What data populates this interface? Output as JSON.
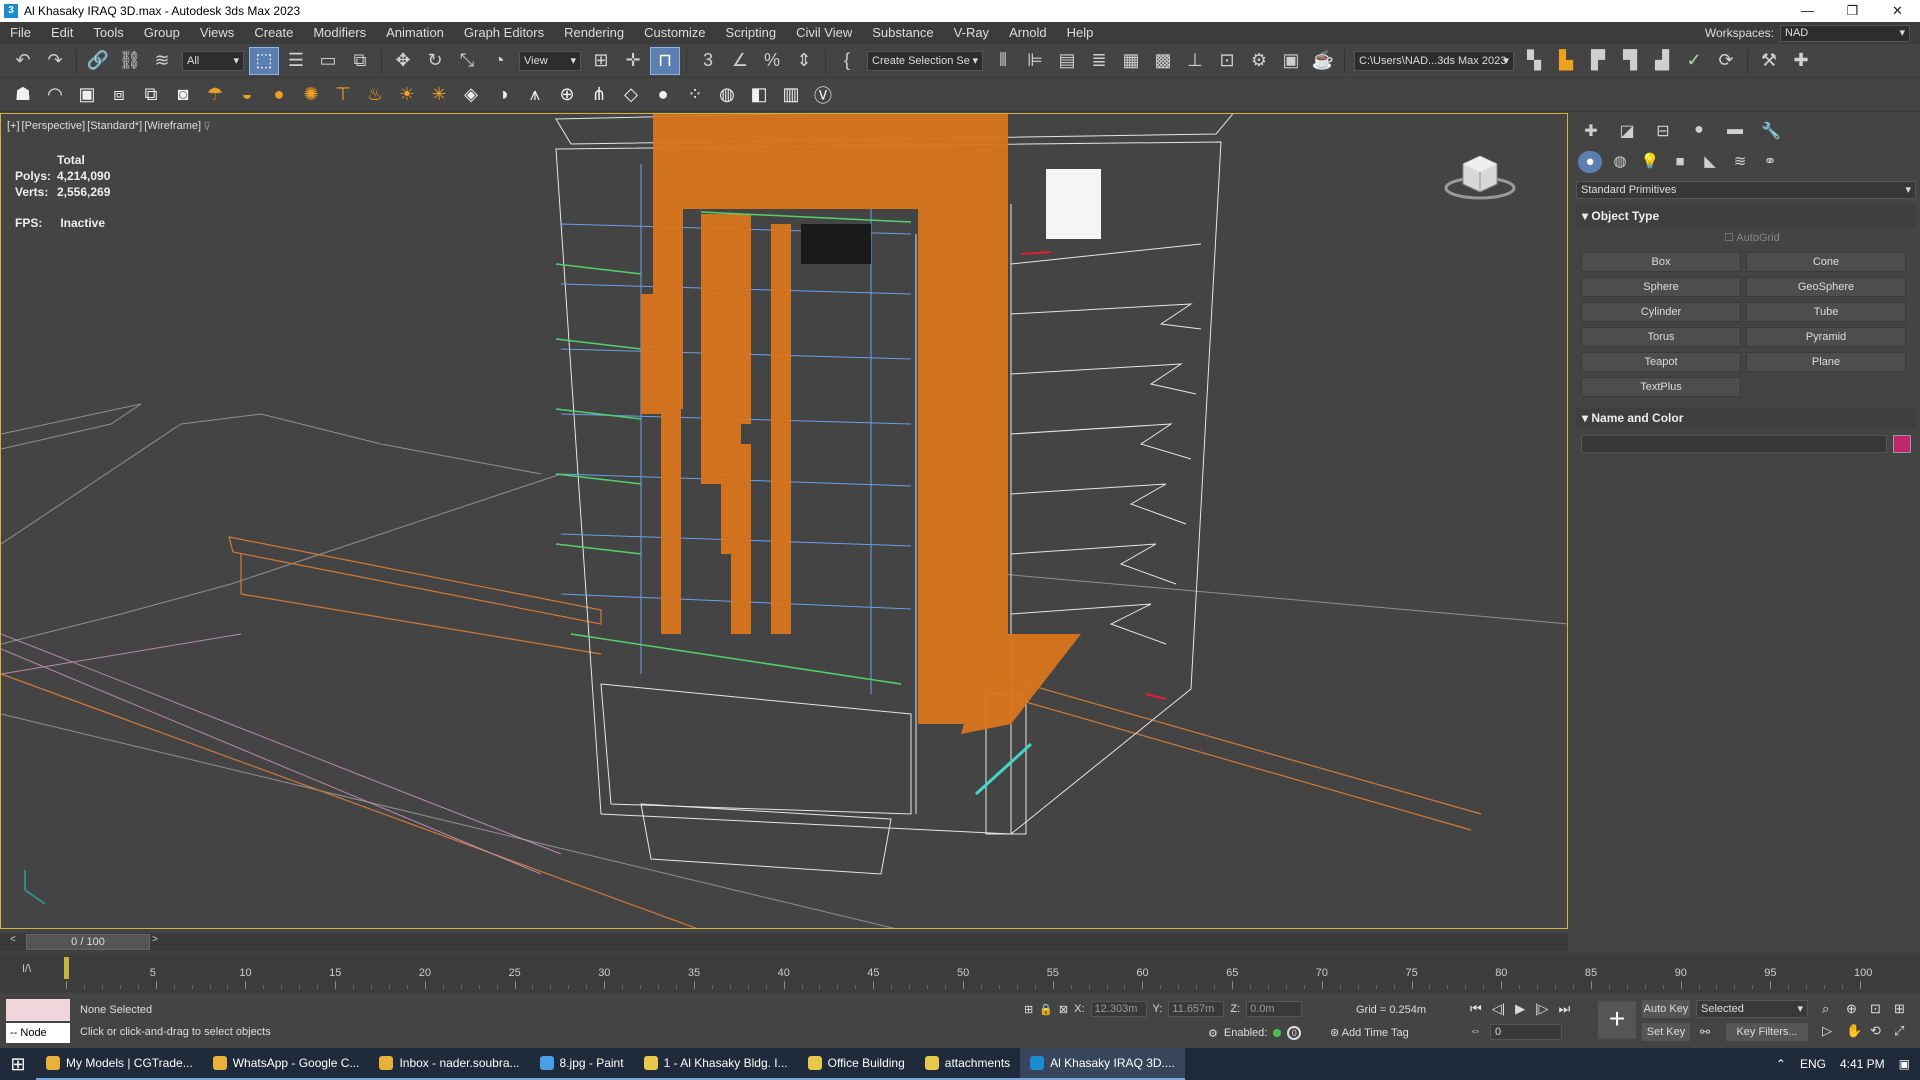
{
  "window": {
    "title": "Al Khasaky IRAQ 3D.max - Autodesk 3ds Max 2023",
    "controls": [
      "—",
      "❐",
      "✕"
    ]
  },
  "menu": [
    "File",
    "Edit",
    "Tools",
    "Group",
    "Views",
    "Create",
    "Modifiers",
    "Animation",
    "Graph Editors",
    "Rendering",
    "Customize",
    "Scripting",
    "Civil View",
    "Substance",
    "V-Ray",
    "Arnold",
    "Help"
  ],
  "workspace": {
    "label": "Workspaces:",
    "value": "NAD"
  },
  "toolbar": {
    "filter_value": "All",
    "refcoord_value": "View",
    "selection_set": "Create Selection Se",
    "project_path": "C:\\Users\\NAD...3ds Max 2023"
  },
  "viewport": {
    "label_parts": [
      "[+]",
      "[Perspective]",
      "[Standard*]",
      "[Wireframe]"
    ],
    "stats_header": "Total",
    "stats": [
      {
        "k": "Polys:",
        "v": "4,214,090"
      },
      {
        "k": "Verts:",
        "v": "2,556,269"
      }
    ],
    "fps_label": "FPS:",
    "fps_value": "Inactive"
  },
  "command_panel": {
    "category": "Standard Primitives",
    "object_type_title": "Object Type",
    "autogrid": "AutoGrid",
    "primitives": [
      "Box",
      "Cone",
      "Sphere",
      "GeoSphere",
      "Cylinder",
      "Tube",
      "Torus",
      "Pyramid",
      "Teapot",
      "Plane",
      "TextPlus"
    ],
    "name_color_title": "Name and Color",
    "color": "#c0286d"
  },
  "timeline": {
    "slider_text": "0 / 100",
    "ticks": [
      5,
      10,
      15,
      20,
      25,
      30,
      35,
      40,
      45,
      50,
      55,
      60,
      65,
      70,
      75,
      80,
      85,
      90,
      95,
      100
    ]
  },
  "status": {
    "selection": "None Selected",
    "prompt": "Click or click-and-drag to select objects",
    "node": "-- Node",
    "x": "12.303m",
    "y": "11.657m",
    "z": "0.0m",
    "grid": "Grid = 0.254m",
    "enabled_label": "Enabled:",
    "add_time_tag": "Add Time Tag",
    "frame": "0",
    "auto_key": "Auto Key",
    "set_key": "Set Key",
    "selected": "Selected",
    "key_filters": "Key Filters..."
  },
  "taskbar": {
    "tasks": [
      {
        "label": "My Models | CGTrade...",
        "color": "#e8b23a"
      },
      {
        "label": "WhatsApp - Google C...",
        "color": "#e8b23a"
      },
      {
        "label": "Inbox - nader.soubra...",
        "color": "#e8b23a"
      },
      {
        "label": "8.jpg - Paint",
        "color": "#4aa0e8"
      },
      {
        "label": "1 - Al Khasaky Bldg. I...",
        "color": "#e8c84a"
      },
      {
        "label": "Office Building",
        "color": "#e8c84a"
      },
      {
        "label": "attachments",
        "color": "#e8c84a"
      },
      {
        "label": "Al Khasaky IRAQ 3D....",
        "color": "#1a8ccf"
      }
    ],
    "lang": "ENG",
    "time": "4:41 PM"
  }
}
